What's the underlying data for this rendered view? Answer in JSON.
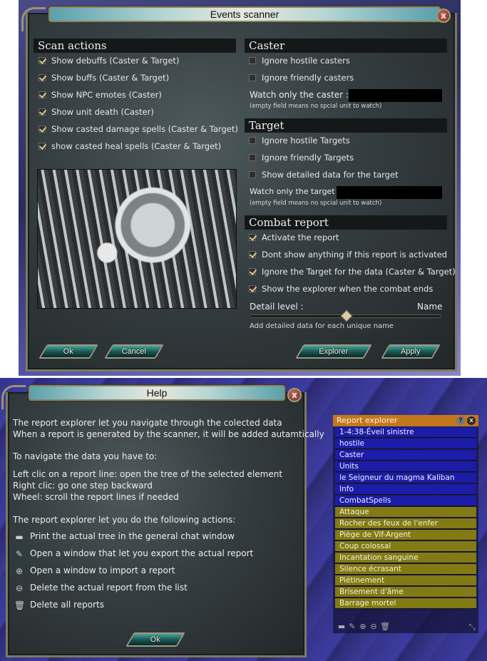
{
  "scanner": {
    "title": "Events scanner",
    "close": "x",
    "scan_actions": {
      "heading": "Scan actions",
      "items": [
        {
          "label": "Show debuffs (Caster & Target)",
          "checked": true
        },
        {
          "label": "Show buffs (Caster & Target)",
          "checked": true
        },
        {
          "label": "Show NPC emotes (Caster)",
          "checked": true
        },
        {
          "label": "Show unit death (Caster)",
          "checked": true
        },
        {
          "label": "Show casted damage spells (Caster & Target)",
          "checked": true
        },
        {
          "label": "show casted heal spells (Caster & Target)",
          "checked": true
        }
      ]
    },
    "caster": {
      "heading": "Caster",
      "items": [
        {
          "label": "Ignore hostile casters",
          "checked": false
        },
        {
          "label": "Ignore friendly casters",
          "checked": false
        }
      ],
      "watch_label": "Watch only the caster :",
      "watch_value": "",
      "hint": "(empty field means no spcial unit to watch)"
    },
    "target": {
      "heading": "Target",
      "items": [
        {
          "label": "Ignore hostile Targets",
          "checked": false
        },
        {
          "label": "Ignore friendly Targets",
          "checked": false
        },
        {
          "label": "Show detailed data for the target",
          "checked": false
        }
      ],
      "watch_label": "Watch only the target :",
      "watch_value": "",
      "hint": "(empty field means no spcial unit to watch)"
    },
    "combat_report": {
      "heading": "Combat report",
      "items": [
        {
          "label": "Activate the report",
          "checked": true
        },
        {
          "label": "Dont show anything if this report is activated",
          "checked": true
        },
        {
          "label": "Ignore the Target for the data (Caster & Target)",
          "checked": true
        },
        {
          "label": "Show the explorer when the combat ends",
          "checked": true
        }
      ],
      "detail_label": "Detail level :",
      "detail_value": "Name",
      "detail_slider_fraction": 0.5,
      "detail_desc": "Add detailed data for each unique name"
    },
    "buttons": {
      "ok": "Ok",
      "cancel": "Cancel",
      "explorer": "Explorer",
      "apply": "Apply"
    }
  },
  "help": {
    "title": "Help",
    "close": "x",
    "intro": [
      "The report explorer let you navigate through the colected data",
      "When a report is generated by the scanner, it will be added autamtically"
    ],
    "nav_heading": "To navigate the data you have to:",
    "nav": [
      "Left clic on a report line: open the tree of the selected element",
      "Right clic: go one step backward",
      "Wheel: scroll the report lines if needed"
    ],
    "actions_heading": "The report explorer let you do the following actions:",
    "actions": [
      {
        "icon": "print-icon",
        "glyph": "▬",
        "label": "Print the actual tree in the general chat window"
      },
      {
        "icon": "export-icon",
        "glyph": "✎",
        "label": "Open a window that let you export the actual report"
      },
      {
        "icon": "import-icon",
        "glyph": "⊕",
        "label": "Open a window to import a report"
      },
      {
        "icon": "delete-report-icon",
        "glyph": "⊖",
        "label": "Delete the actual report from the list"
      },
      {
        "icon": "trash-icon",
        "glyph": "🗑",
        "label": "Delete all reports"
      }
    ],
    "ok": "Ok"
  },
  "explorer": {
    "title": "Report explorer",
    "help_glyph": "?",
    "close_glyph": "x",
    "path_rows": [
      "1-4:38-Éveil sinistre",
      "hostile",
      "Caster",
      "Units",
      "le Seigneur du magma Kaliban",
      "Info",
      "CombatSpells"
    ],
    "spell_rows": [
      "Attaque",
      "Rocher des feux de l'enfer",
      "Piège de Vif-Argent",
      "Coup colossal",
      "Incantation sanguine",
      "Silence écrasant",
      "Piétinement",
      "Brisement d'âme",
      "Barrage mortel"
    ],
    "toolbar": [
      "▬",
      "✎",
      "⊕",
      "⊖",
      "🗑"
    ],
    "resize_glyph": "⤡"
  }
}
